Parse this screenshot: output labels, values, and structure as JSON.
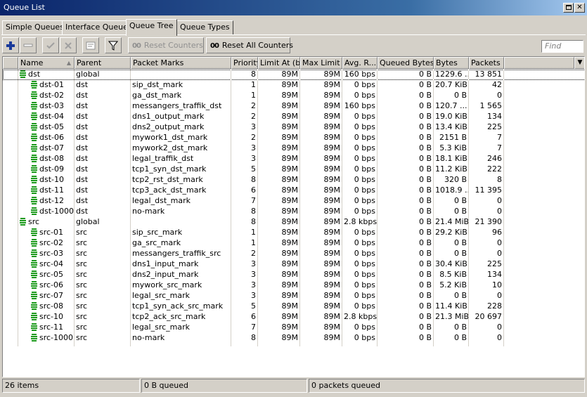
{
  "window": {
    "title": "Queue List"
  },
  "tabs": [
    {
      "label": "Simple Queues",
      "active": false
    },
    {
      "label": "Interface Queues",
      "active": false
    },
    {
      "label": "Queue Tree",
      "active": true
    },
    {
      "label": "Queue Types",
      "active": false
    }
  ],
  "toolbar": {
    "reset_counters": "Reset Counters",
    "reset_all_counters": "Reset All Counters",
    "oo_glyph": "00",
    "find_placeholder": "Find"
  },
  "columns": [
    "Name",
    "Parent",
    "Packet Marks",
    "Priority",
    "Limit At (b...",
    "Max Limit ...",
    "Avg. R...",
    "Queued Bytes",
    "Bytes",
    "Packets"
  ],
  "rows": [
    {
      "level": 0,
      "name": "dst",
      "parent": "global",
      "marks": "",
      "priority": "8",
      "limit_at": "89M",
      "max_limit": "89M",
      "avg_rate": "160 bps",
      "queued_bytes": "0 B",
      "bytes": "1229.6 ...",
      "packets": "13 851"
    },
    {
      "level": 1,
      "name": "dst-01",
      "parent": "dst",
      "marks": "sip_dst_mark",
      "priority": "1",
      "limit_at": "89M",
      "max_limit": "89M",
      "avg_rate": "0 bps",
      "queued_bytes": "0 B",
      "bytes": "20.7 KiB",
      "packets": "42"
    },
    {
      "level": 1,
      "name": "dst-02",
      "parent": "dst",
      "marks": "ga_dst_mark",
      "priority": "1",
      "limit_at": "89M",
      "max_limit": "89M",
      "avg_rate": "0 bps",
      "queued_bytes": "0 B",
      "bytes": "0 B",
      "packets": "0"
    },
    {
      "level": 1,
      "name": "dst-03",
      "parent": "dst",
      "marks": "messangers_traffik_dst",
      "priority": "2",
      "limit_at": "89M",
      "max_limit": "89M",
      "avg_rate": "160 bps",
      "queued_bytes": "0 B",
      "bytes": "120.7 ...",
      "packets": "1 565"
    },
    {
      "level": 1,
      "name": "dst-04",
      "parent": "dst",
      "marks": "dns1_output_mark",
      "priority": "2",
      "limit_at": "89M",
      "max_limit": "89M",
      "avg_rate": "0 bps",
      "queued_bytes": "0 B",
      "bytes": "19.0 KiB",
      "packets": "134"
    },
    {
      "level": 1,
      "name": "dst-05",
      "parent": "dst",
      "marks": "dns2_output_mark",
      "priority": "3",
      "limit_at": "89M",
      "max_limit": "89M",
      "avg_rate": "0 bps",
      "queued_bytes": "0 B",
      "bytes": "13.4 KiB",
      "packets": "225"
    },
    {
      "level": 1,
      "name": "dst-06",
      "parent": "dst",
      "marks": "mywork1_dst_mark",
      "priority": "2",
      "limit_at": "89M",
      "max_limit": "89M",
      "avg_rate": "0 bps",
      "queued_bytes": "0 B",
      "bytes": "2151 B",
      "packets": "7"
    },
    {
      "level": 1,
      "name": "dst-07",
      "parent": "dst",
      "marks": "mywork2_dst_mark",
      "priority": "3",
      "limit_at": "89M",
      "max_limit": "89M",
      "avg_rate": "0 bps",
      "queued_bytes": "0 B",
      "bytes": "5.3 KiB",
      "packets": "7"
    },
    {
      "level": 1,
      "name": "dst-08",
      "parent": "dst",
      "marks": "legal_traffik_dst",
      "priority": "3",
      "limit_at": "89M",
      "max_limit": "89M",
      "avg_rate": "0 bps",
      "queued_bytes": "0 B",
      "bytes": "18.1 KiB",
      "packets": "246"
    },
    {
      "level": 1,
      "name": "dst-09",
      "parent": "dst",
      "marks": "tcp1_syn_dst_mark",
      "priority": "5",
      "limit_at": "89M",
      "max_limit": "89M",
      "avg_rate": "0 bps",
      "queued_bytes": "0 B",
      "bytes": "11.2 KiB",
      "packets": "222"
    },
    {
      "level": 1,
      "name": "dst-10",
      "parent": "dst",
      "marks": "tcp2_rst_dst_mark",
      "priority": "8",
      "limit_at": "89M",
      "max_limit": "89M",
      "avg_rate": "0 bps",
      "queued_bytes": "0 B",
      "bytes": "320 B",
      "packets": "8"
    },
    {
      "level": 1,
      "name": "dst-11",
      "parent": "dst",
      "marks": "tcp3_ack_dst_mark",
      "priority": "6",
      "limit_at": "89M",
      "max_limit": "89M",
      "avg_rate": "0 bps",
      "queued_bytes": "0 B",
      "bytes": "1018.9 ...",
      "packets": "11 395"
    },
    {
      "level": 1,
      "name": "dst-12",
      "parent": "dst",
      "marks": "legal_dst_mark",
      "priority": "7",
      "limit_at": "89M",
      "max_limit": "89M",
      "avg_rate": "0 bps",
      "queued_bytes": "0 B",
      "bytes": "0 B",
      "packets": "0"
    },
    {
      "level": 1,
      "name": "dst-1000",
      "parent": "dst",
      "marks": "no-mark",
      "priority": "8",
      "limit_at": "89M",
      "max_limit": "89M",
      "avg_rate": "0 bps",
      "queued_bytes": "0 B",
      "bytes": "0 B",
      "packets": "0"
    },
    {
      "level": 0,
      "name": "src",
      "parent": "global",
      "marks": "",
      "priority": "8",
      "limit_at": "89M",
      "max_limit": "89M",
      "avg_rate": "2.8 kbps",
      "queued_bytes": "0 B",
      "bytes": "21.4 MiB",
      "packets": "21 390"
    },
    {
      "level": 1,
      "name": "src-01",
      "parent": "src",
      "marks": "sip_src_mark",
      "priority": "1",
      "limit_at": "89M",
      "max_limit": "89M",
      "avg_rate": "0 bps",
      "queued_bytes": "0 B",
      "bytes": "29.2 KiB",
      "packets": "96"
    },
    {
      "level": 1,
      "name": "src-02",
      "parent": "src",
      "marks": "ga_src_mark",
      "priority": "1",
      "limit_at": "89M",
      "max_limit": "89M",
      "avg_rate": "0 bps",
      "queued_bytes": "0 B",
      "bytes": "0 B",
      "packets": "0"
    },
    {
      "level": 1,
      "name": "src-03",
      "parent": "src",
      "marks": "messangers_traffik_src",
      "priority": "2",
      "limit_at": "89M",
      "max_limit": "89M",
      "avg_rate": "0 bps",
      "queued_bytes": "0 B",
      "bytes": "0 B",
      "packets": "0"
    },
    {
      "level": 1,
      "name": "src-04",
      "parent": "src",
      "marks": "dns1_input_mark",
      "priority": "3",
      "limit_at": "89M",
      "max_limit": "89M",
      "avg_rate": "0 bps",
      "queued_bytes": "0 B",
      "bytes": "30.4 KiB",
      "packets": "225"
    },
    {
      "level": 1,
      "name": "src-05",
      "parent": "src",
      "marks": "dns2_input_mark",
      "priority": "3",
      "limit_at": "89M",
      "max_limit": "89M",
      "avg_rate": "0 bps",
      "queued_bytes": "0 B",
      "bytes": "8.5 KiB",
      "packets": "134"
    },
    {
      "level": 1,
      "name": "src-06",
      "parent": "src",
      "marks": "mywork_src_mark",
      "priority": "3",
      "limit_at": "89M",
      "max_limit": "89M",
      "avg_rate": "0 bps",
      "queued_bytes": "0 B",
      "bytes": "5.2 KiB",
      "packets": "10"
    },
    {
      "level": 1,
      "name": "src-07",
      "parent": "src",
      "marks": "legal_src_mark",
      "priority": "3",
      "limit_at": "89M",
      "max_limit": "89M",
      "avg_rate": "0 bps",
      "queued_bytes": "0 B",
      "bytes": "0 B",
      "packets": "0"
    },
    {
      "level": 1,
      "name": "src-08",
      "parent": "src",
      "marks": "tcp1_syn_ack_src_mark",
      "priority": "5",
      "limit_at": "89M",
      "max_limit": "89M",
      "avg_rate": "0 bps",
      "queued_bytes": "0 B",
      "bytes": "11.4 KiB",
      "packets": "228"
    },
    {
      "level": 1,
      "name": "src-10",
      "parent": "src",
      "marks": "tcp2_ack_src_mark",
      "priority": "6",
      "limit_at": "89M",
      "max_limit": "89M",
      "avg_rate": "2.8 kbps",
      "queued_bytes": "0 B",
      "bytes": "21.3 MiB",
      "packets": "20 697"
    },
    {
      "level": 1,
      "name": "src-11",
      "parent": "src",
      "marks": "legal_src_mark",
      "priority": "7",
      "limit_at": "89M",
      "max_limit": "89M",
      "avg_rate": "0 bps",
      "queued_bytes": "0 B",
      "bytes": "0 B",
      "packets": "0"
    },
    {
      "level": 1,
      "name": "src-1000",
      "parent": "src",
      "marks": "no-mark",
      "priority": "8",
      "limit_at": "89M",
      "max_limit": "89M",
      "avg_rate": "0 bps",
      "queued_bytes": "0 B",
      "bytes": "0 B",
      "packets": "0"
    }
  ],
  "status": {
    "items": "26 items",
    "queued": "0 B queued",
    "packets_queued": "0 packets queued"
  },
  "colors": {
    "queue_icon": "#1a9a1a",
    "title_bar": "#0a246a",
    "add_icon": "#1a3a9a"
  },
  "icons": [
    "plus-icon",
    "minus-icon",
    "check-icon",
    "cross-icon",
    "comment-icon",
    "filter-icon",
    "restore-icon",
    "close-icon",
    "sort-asc-icon",
    "dropdown-icon",
    "queue-icon"
  ]
}
